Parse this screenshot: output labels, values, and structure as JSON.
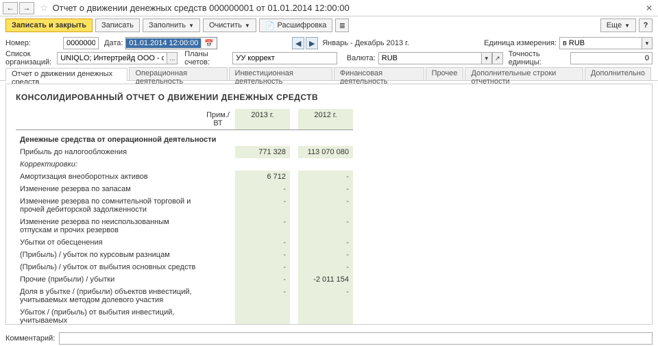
{
  "title": "Отчет о движении денежных средств 000000001 от 01.01.2014 12:00:00",
  "toolbar": {
    "save_close": "Записать и закрыть",
    "save": "Записать",
    "fill": "Заполнить",
    "clear": "Очистить",
    "decrypt": "Расшифровка",
    "more": "Еще"
  },
  "fields": {
    "number_label": "Номер:",
    "number_value": "000000001",
    "date_label": "Дата:",
    "date_value": "01.01.2014 12:00:00",
    "period_text": "Январь - Декабрь 2013 г.",
    "uom_label": "Единица измерения:",
    "uom_value": "в RUB",
    "orgs_label": "Список организаций:",
    "orgs_value": "UNIQLO; Интертрейд ООО - северный филиал;",
    "plan_label": "Планы счетов:",
    "plan_value": "УУ коррект",
    "currency_label": "Валюта:",
    "currency_value": "RUB",
    "precision_label": "Точность единицы:",
    "precision_value": "0",
    "comment_label": "Комментарий:",
    "comment_value": ""
  },
  "tabs": [
    "Отчет о движении денежных средств",
    "Операционная деятельность",
    "Инвестиционная деятельность",
    "Финансовая деятельность",
    "Прочее",
    "Дополнительные строки отчетности",
    "Дополнительно"
  ],
  "report": {
    "title": "КОНСОЛИДИРОВАННЫЙ ОТЧЕТ О ДВИЖЕНИИ ДЕНЕЖНЫХ СРЕДСТВ",
    "col_note": "Прим./ВТ",
    "col_2013": "2013 г.",
    "col_2012": "2012 г.",
    "rows": [
      {
        "type": "section",
        "label": "Денежные средства от операционной деятельности"
      },
      {
        "label": "Прибыль до налогообложения",
        "note": "",
        "y2013": "771 328",
        "y2012": "113 070 080"
      },
      {
        "type": "ital",
        "label": "Корректировки:"
      },
      {
        "label": "Амортизация внеоборотных активов",
        "note": "",
        "y2013": "6 712",
        "y2012": "-"
      },
      {
        "label": "Изменение резерва по запасам",
        "note": "",
        "y2013": "-",
        "y2012": "-"
      },
      {
        "label": "Изменение резерва по сомнительной торговой и прочей дебиторской задолженности",
        "note": "",
        "y2013": "-",
        "y2012": "-"
      },
      {
        "label": "Изменение резерва по неиспользованным отпускам и прочих резервов",
        "note": "",
        "y2013": "-",
        "y2012": "-"
      },
      {
        "label": "Убытки от обесценения",
        "note": "",
        "y2013": "-",
        "y2012": "-"
      },
      {
        "label": "(Прибыль) / убыток по курсовым разницам",
        "note": "",
        "y2013": "-",
        "y2012": "-"
      },
      {
        "label": "(Прибыль) / убыток от выбытия основных средств",
        "note": "",
        "y2013": "-",
        "y2012": "-"
      },
      {
        "label": "Прочие (прибыли) / убытки",
        "note": "",
        "y2013": "-",
        "y2012": "-2 011 154"
      },
      {
        "label": "Доля в убытке / (прибыли) объектов инвестиций, учитываемых методом долевого участия",
        "note": "",
        "y2013": "-",
        "y2012": "-"
      },
      {
        "label": "Убыток / (прибыль) от выбытия инвестиций, учитываемых",
        "note": "",
        "y2013": "",
        "y2012": ""
      }
    ]
  }
}
